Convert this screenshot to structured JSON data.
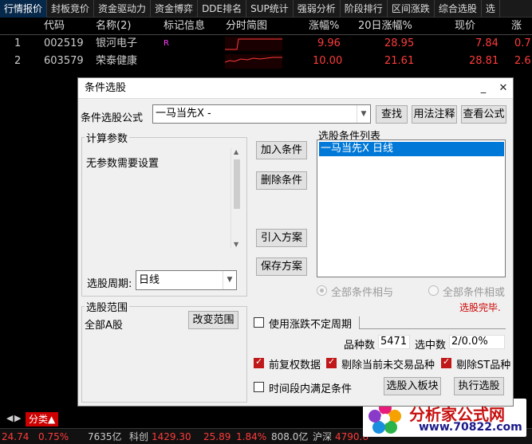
{
  "top_tabs": [
    "行情报价",
    "封板竞价",
    "资金驱动力",
    "资金博弈",
    "DDE排名",
    "SUP统计",
    "强弱分析",
    "阶段排行",
    "区间涨跌",
    "综合选股",
    "选"
  ],
  "quote_table": {
    "headers": [
      "",
      "代码",
      "名称(2)",
      "标记信息",
      "分时简图",
      "涨幅%",
      "20日涨幅%",
      "现价",
      "涨"
    ],
    "rows": [
      {
        "idx": "1",
        "code": "002519",
        "name": "银河电子",
        "mark": "R",
        "change": "9.96",
        "change20": "28.95",
        "price": "7.84",
        "extra": "0.7"
      },
      {
        "idx": "2",
        "code": "603579",
        "name": "荣泰健康",
        "mark": "",
        "change": "10.00",
        "change20": "21.61",
        "price": "28.81",
        "extra": "2.6"
      }
    ]
  },
  "bottom_tab": "分类▲",
  "status_bar": {
    "v1": "24.74",
    "v2": "0.75%",
    "v3": "7635亿",
    "k_label": "科创",
    "k_value": "1429.30",
    "v4": "25.89",
    "v5": "1.84%",
    "v6": "808.0亿",
    "hs_label": "沪深",
    "hs_value": "4790.6"
  },
  "dialog": {
    "title": "条件选股",
    "formula_label": "条件选股公式",
    "formula_value": "一马当先X  -",
    "btn_find": "查找",
    "btn_usage": "用法注释",
    "btn_view": "查看公式",
    "params_title": "计算参数",
    "params_text": "无参数需要设置",
    "period_label": "选股周期:",
    "period_value": "日线",
    "btn_add": "加入条件",
    "btn_delete": "删除条件",
    "btn_import": "引入方案",
    "btn_save": "保存方案",
    "list_title": "选股条件列表",
    "list_items": [
      "一马当先X  日线"
    ],
    "radio_and": "全部条件相与",
    "radio_or": "全部条件相或",
    "status_done": "选股完毕.",
    "range_title": "选股范围",
    "range_value": "全部A股",
    "btn_range": "改变范围",
    "chk_uncertain": "使用涨跌不定周期",
    "count_label": "品种数",
    "count_value": "5471",
    "selected_label": "选中数",
    "selected_value": "2/0.0%",
    "chk_adjust": "前复权数据",
    "chk_notrade": "剔除当前未交易品种",
    "chk_st": "剔除ST品种",
    "chk_period": "时间段内满足条件",
    "btn_toblock": "选股入板块",
    "btn_exec": "执行选股"
  },
  "logo": {
    "text": "分析家公式网",
    "url": "www.70822.com"
  },
  "colors": {
    "accent_red": "#c01818",
    "selection_blue": "#0078d7",
    "quote_red": "#ff3b3b"
  }
}
